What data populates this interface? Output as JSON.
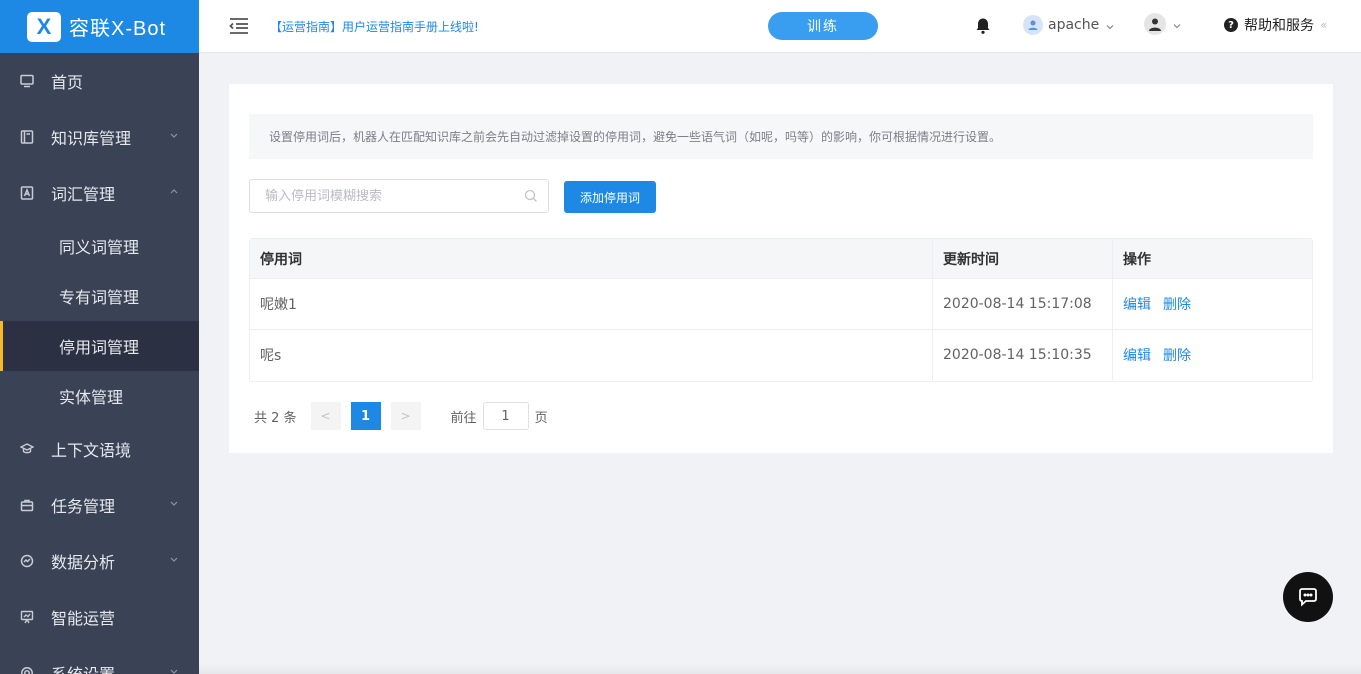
{
  "logo": {
    "mark": "X",
    "text": "容联X-Bot"
  },
  "sidebar": {
    "items": [
      {
        "label": "首页",
        "icon": "monitor-icon"
      },
      {
        "label": "知识库管理",
        "icon": "book-icon",
        "expanded": false
      },
      {
        "label": "词汇管理",
        "icon": "vocab-icon",
        "expanded": true
      },
      {
        "label": "上下文语境",
        "icon": "graduation-cap-icon"
      },
      {
        "label": "任务管理",
        "icon": "briefcase-icon",
        "expanded": false
      },
      {
        "label": "数据分析",
        "icon": "dashboard-icon",
        "expanded": false
      },
      {
        "label": "智能运营",
        "icon": "presentation-icon"
      },
      {
        "label": "系统设置",
        "icon": "settings-icon",
        "expanded": false
      }
    ],
    "sub_items": [
      {
        "label": "同义词管理",
        "active": false
      },
      {
        "label": "专有词管理",
        "active": false
      },
      {
        "label": "停用词管理",
        "active": true
      },
      {
        "label": "实体管理",
        "active": false
      }
    ]
  },
  "header": {
    "notice": "【运营指南】用户运营指南手册上线啦!",
    "train_label": "训练",
    "username": "apache",
    "help_label": "帮助和服务",
    "collapse_glyph": "«"
  },
  "main": {
    "tip": "设置停用词后，机器人在匹配知识库之前会先自动过滤掉设置的停用词，避免一些语气词（如呢，吗等）的影响，你可根据情况进行设置。",
    "search_placeholder": "输入停用词模糊搜索",
    "add_button_label": "添加停用词",
    "table": {
      "headers": [
        "停用词",
        "更新时间",
        "操作"
      ],
      "rows": [
        {
          "word": "呢嫩1",
          "updated": "2020-08-14 15:17:08",
          "edit": "编辑",
          "delete": "删除"
        },
        {
          "word": "呢s",
          "updated": "2020-08-14 15:10:35",
          "edit": "编辑",
          "delete": "删除"
        }
      ]
    },
    "pagination": {
      "total_text": "共 2 条",
      "prev": "<",
      "current_page": "1",
      "next": ">",
      "goto_label": "前往",
      "goto_value": "1",
      "page_unit": "页"
    }
  },
  "colors": {
    "brand": "#1e88e5",
    "sidebar_bg": "#3a4256",
    "active_indicator": "#f7b924"
  }
}
